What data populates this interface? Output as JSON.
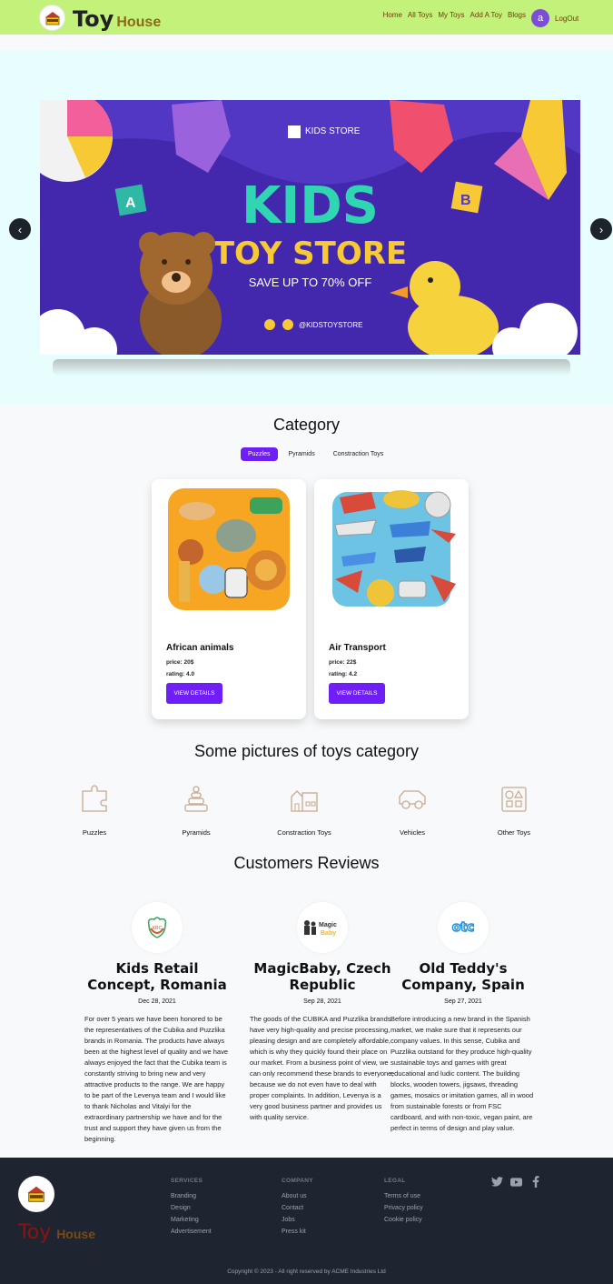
{
  "nav": {
    "brand_toy": "Toy",
    "brand_house": "House",
    "links": [
      "Home",
      "All Toys",
      "My Toys",
      "Add A Toy",
      "Blogs"
    ],
    "avatar_letter": "a",
    "logout": "LogOut",
    "bg_color": "#c3f27a"
  },
  "hero": {
    "banner_kids_store": "KIDS STORE",
    "banner_line1": "KIDS",
    "banner_line2": "TOY STORE",
    "banner_line3": "SAVE UP TO 70% OFF",
    "banner_handle": "@KIDSTOYSTORE",
    "prev_icon": "chevron-left",
    "next_icon": "chevron-right"
  },
  "category": {
    "title": "Category",
    "tabs": [
      "Puzzles",
      "Pyramids",
      "Constraction Toys"
    ],
    "active_tab": "Puzzles",
    "cards": [
      {
        "name": "African animals",
        "price": "price: 20$",
        "rating": "rating: 4.0",
        "button": "VIEW DETAILS"
      },
      {
        "name": "Air Transport",
        "price": "price: 22$",
        "rating": "rating: 4.2",
        "button": "VIEW DETAILS"
      }
    ]
  },
  "pictures": {
    "title": "Some pictures of toys category",
    "items": [
      {
        "label": "Puzzles",
        "icon": "puzzle-icon"
      },
      {
        "label": "Pyramids",
        "icon": "pyramid-icon"
      },
      {
        "label": "Constraction Toys",
        "icon": "castle-icon"
      },
      {
        "label": "Vehicles",
        "icon": "car-icon"
      },
      {
        "label": "Other Toys",
        "icon": "shapes-icon"
      }
    ]
  },
  "reviews": {
    "title": "Customers Reviews",
    "items": [
      {
        "name": "Kids Retail Concept, Romania",
        "date": "Dec 28, 2021",
        "logo_text": "KRC",
        "text": "For over 5 years we have been honored to be the representatives of the Cubika and Puzzlika brands in Romania. The products have always been at the highest level of quality and we have always enjoyed the fact that the Cubika team is constantly striving to bring new and very attractive products to the range. We are happy to be part of the Levenya team and I would like to thank Nicholas and Vitalyi for the extraordinary partnership we have and for the trust and support they have given us from the beginning."
      },
      {
        "name": "MagicBaby, Czech Republic",
        "date": "Sep 28, 2021",
        "logo_text": "Magic Baby",
        "text": "The goods of the CUBIKA and Puzzlika brands have very high-quality and precise processing, pleasing design and are completely affordable, which is why they quickly found their place on our market. From a business point of view, we can only recommend these brands to everyone, because we do not even have to deal with proper complaints. In addition, Levenya is a very good business partner and provides us with quality service."
      },
      {
        "name": "Old Teddy's Company, Spain",
        "date": "Sep 27, 2021",
        "logo_text": "otc",
        "text": "Before introducing a new brand in the Spanish market, we make sure that it represents our company values. In this sense, Cubika and Puzzlika outstand for they produce high-quality sustainable toys and games with great educational and ludic content. The building blocks, wooden towers, jigsaws, threading games, mosaics or imitation games, all in wood from sustainable forests or from FSC cardboard, and with non-toxic, vegan paint, are perfect in terms of design and play value."
      }
    ]
  },
  "footer": {
    "brand_toy": "Toy",
    "brand_house": "House",
    "services": {
      "heading": "SERVICES",
      "links": [
        "Branding",
        "Design",
        "Marketing",
        "Advertisement"
      ]
    },
    "company": {
      "heading": "COMPANY",
      "links": [
        "About us",
        "Contact",
        "Jobs",
        "Press kit"
      ]
    },
    "legal": {
      "heading": "LEGAL",
      "links": [
        "Terms of use",
        "Privacy policy",
        "Cookie policy"
      ]
    },
    "socials": [
      "twitter-icon",
      "youtube-icon",
      "facebook-icon"
    ],
    "copyright": "Copyright © 2023 - All right reserved by ACME Industries Ltd"
  }
}
